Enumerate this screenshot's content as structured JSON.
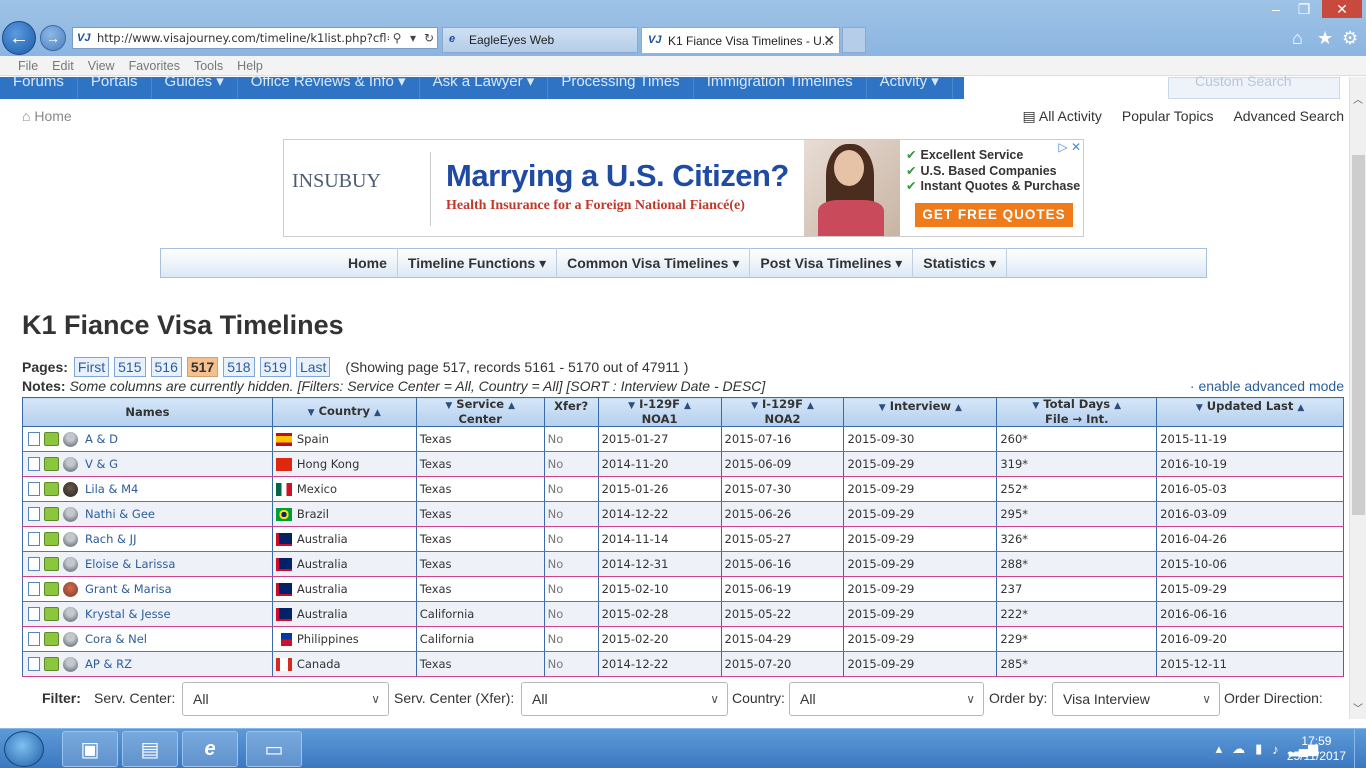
{
  "browser": {
    "url": "http://www.visajourney.com/timeline/k1list.php?cfl=(",
    "tabs": [
      {
        "label": "EagleEyes Web"
      },
      {
        "label": "K1 Fiance Visa Timelines - U..."
      }
    ],
    "menu": [
      "File",
      "Edit",
      "View",
      "Favorites",
      "Tools",
      "Help"
    ]
  },
  "site_nav": {
    "items": [
      "Forums",
      "Portals",
      "Guides ▾",
      "Office Reviews & Info ▾",
      "Ask a Lawyer ▾",
      "Processing Times",
      "Immigration Timelines",
      "Activity ▾"
    ],
    "search_placeholder": "Custom Search"
  },
  "crumb": {
    "home": "Home"
  },
  "toplinks": {
    "all_activity": "All Activity",
    "popular": "Popular Topics",
    "advanced": "Advanced Search"
  },
  "ad": {
    "logo": "INSUBUY",
    "headline": "Marrying a U.S. Citizen?",
    "sub": "Health Insurance for a Foreign National Fiancé(e)",
    "checks": [
      "Excellent Service",
      "U.S. Based Companies",
      "Instant Quotes & Purchase"
    ],
    "cta": "GET FREE QUOTES"
  },
  "visa_nav": [
    "Home",
    "Timeline Functions ▾",
    "Common Visa Timelines ▾",
    "Post Visa Timelines ▾",
    "Statistics ▾"
  ],
  "page": {
    "title": "K1 Fiance Visa Timelines",
    "pages_label": "Pages:",
    "pages": [
      "First",
      "515",
      "516",
      "517",
      "518",
      "519",
      "Last"
    ],
    "current_page": "517",
    "showing": "(Showing page 517, records 5161 - 5170 out of 47911 )",
    "notes_label": "Notes:",
    "notes": "Some columns are currently hidden. [Filters: Service Center = All, Country = All] [SORT : Interview Date - DESC]",
    "advanced_link": "· enable advanced mode"
  },
  "table": {
    "headers": {
      "names": "Names",
      "country": "Country",
      "service_center_1": "Service",
      "service_center_2": "Center",
      "xfer": "Xfer?",
      "noa1_1": "I-129F",
      "noa1_2": "NOA1",
      "noa2_1": "I-129F",
      "noa2_2": "NOA2",
      "interview": "Interview",
      "total_1": "Total Days",
      "total_2": "File → Int.",
      "updated": "Updated Last"
    },
    "rows": [
      {
        "name": "A & D",
        "country": "Spain",
        "center": "Texas",
        "xfer": "No",
        "noa1": "2015-01-27",
        "noa2": "2015-07-16",
        "interview": "2015-09-30",
        "total": "260*",
        "updated": "2015-11-19"
      },
      {
        "name": "V & G",
        "country": "Hong Kong",
        "center": "Texas",
        "xfer": "No",
        "noa1": "2014-11-20",
        "noa2": "2015-06-09",
        "interview": "2015-09-29",
        "total": "319*",
        "updated": "2016-10-19"
      },
      {
        "name": "Lila & M4",
        "country": "Mexico",
        "center": "Texas",
        "xfer": "No",
        "noa1": "2015-01-26",
        "noa2": "2015-07-30",
        "interview": "2015-09-29",
        "total": "252*",
        "updated": "2016-05-03"
      },
      {
        "name": "Nathi & Gee",
        "country": "Brazil",
        "center": "Texas",
        "xfer": "No",
        "noa1": "2014-12-22",
        "noa2": "2015-06-26",
        "interview": "2015-09-29",
        "total": "295*",
        "updated": "2016-03-09"
      },
      {
        "name": "Rach & JJ",
        "country": "Australia",
        "center": "Texas",
        "xfer": "No",
        "noa1": "2014-11-14",
        "noa2": "2015-05-27",
        "interview": "2015-09-29",
        "total": "326*",
        "updated": "2016-04-26"
      },
      {
        "name": "Eloise & Larissa",
        "country": "Australia",
        "center": "Texas",
        "xfer": "No",
        "noa1": "2014-12-31",
        "noa2": "2015-06-16",
        "interview": "2015-09-29",
        "total": "288*",
        "updated": "2015-10-06"
      },
      {
        "name": "Grant & Marisa",
        "country": "Australia",
        "center": "Texas",
        "xfer": "No",
        "noa1": "2015-02-10",
        "noa2": "2015-06-19",
        "interview": "2015-09-29",
        "total": "237",
        "updated": "2015-09-29"
      },
      {
        "name": "Krystal & Jesse",
        "country": "Australia",
        "center": "California",
        "xfer": "No",
        "noa1": "2015-02-28",
        "noa2": "2015-05-22",
        "interview": "2015-09-29",
        "total": "222*",
        "updated": "2016-06-16"
      },
      {
        "name": "Cora & Nel",
        "country": "Philippines",
        "center": "California",
        "xfer": "No",
        "noa1": "2015-02-20",
        "noa2": "2015-04-29",
        "interview": "2015-09-29",
        "total": "229*",
        "updated": "2016-09-20"
      },
      {
        "name": "AP & RZ",
        "country": "Canada",
        "center": "Texas",
        "xfer": "No",
        "noa1": "2014-12-22",
        "noa2": "2015-07-20",
        "interview": "2015-09-29",
        "total": "285*",
        "updated": "2015-12-11"
      }
    ]
  },
  "filter": {
    "label": "Filter:",
    "serv_center_label": "Serv. Center:",
    "serv_center_value": "All",
    "serv_center_xfer_label": "Serv. Center (Xfer):",
    "serv_center_xfer_value": "All",
    "country_label": "Country:",
    "country_value": "All",
    "order_by_label": "Order by:",
    "order_by_value": "Visa Interview",
    "order_dir_label": "Order Direction:"
  },
  "taskbar": {
    "time": "17:59",
    "date": "25/11/2017"
  }
}
